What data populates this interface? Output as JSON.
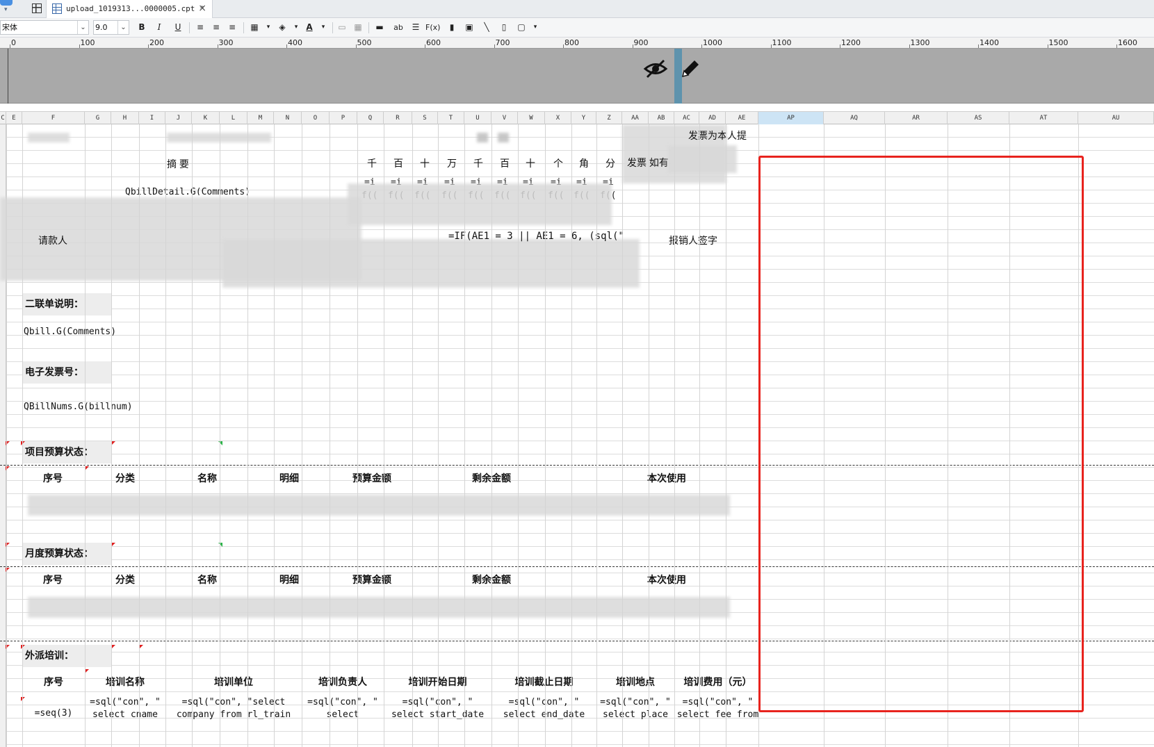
{
  "tab": {
    "title": "upload_1019313...0000005.cpt *",
    "close": "×"
  },
  "toolbar": {
    "font_name": "宋体",
    "font_size": "9.0",
    "bold": "B",
    "italic": "I",
    "underline": "U",
    "ab": "ab",
    "fx": "F(x)"
  },
  "ruler": {
    "labels": [
      "0",
      "100",
      "200",
      "300",
      "400",
      "500",
      "600",
      "700",
      "800",
      "900",
      "1000",
      "1100",
      "1200",
      "1300",
      "1400",
      "1500",
      "1600"
    ]
  },
  "columns": [
    "C",
    "E",
    "F",
    "G",
    "H",
    "I",
    "J",
    "K",
    "L",
    "M",
    "N",
    "O",
    "P",
    "Q",
    "R",
    "S",
    "T",
    "U",
    "V",
    "W",
    "X",
    "Y",
    "Z",
    "AA",
    "AB",
    "AC",
    "AD",
    "AE",
    "AP",
    "AQ",
    "AR",
    "AS",
    "AT",
    "AU"
  ],
  "selected_column": "AP",
  "sheet": {
    "top_note": "发票为本人提",
    "summary_header": "摘          要",
    "digit_headers": [
      "千",
      "百",
      "十",
      "万",
      "千",
      "百",
      "十",
      "个",
      "角",
      "分"
    ],
    "invoice_label": "发票 如有",
    "detail_formula": "QbillDetail.G(Comments)",
    "digit_formula_a": "=i",
    "digit_formula_b": "f((",
    "request_label": "请款人",
    "if_formula": "=IF(AE1 = 3 || AE1 = 6, (sql(\"",
    "sign_label": "报销人签字",
    "second_copy_label": "二联单说明：",
    "second_copy_formula": "Qbill.G(Comments)",
    "einvoice_label": "电子发票号：",
    "einvoice_formula": "QBillNums.G(billnum)",
    "project_budget_label": "项目预算状态：",
    "monthly_budget_label": "月度预算状态：",
    "budget_headers": [
      "序号",
      "分类",
      "名称",
      "明细",
      "预算金额",
      "剩余金额",
      "本次使用"
    ],
    "training_label": "外派培训：",
    "training_headers": [
      "序号",
      "培训名称",
      "培训单位",
      "培训负责人",
      "培训开始日期",
      "培训截止日期",
      "培训地点",
      "培训费用（元）"
    ],
    "training_row_line1": [
      "=seq(3)",
      "=sql(\"con\", \"",
      "=sql(\"con\", \"select",
      "=sql(\"con\", \"",
      "=sql(\"con\", \"",
      "=sql(\"con\", \"",
      "=sql(\"con\", \"",
      "=sql(\"con\", \""
    ],
    "training_row_line2": [
      "",
      "select cname",
      "company from rl_train",
      "select",
      "select start_date",
      "select end_date",
      "select place",
      "select fee from"
    ]
  },
  "icons": [
    "eye-slash-icon",
    "pencil-icon",
    "grid-icon",
    "doc-icon"
  ],
  "colors": {
    "highlight": "#e8231e",
    "selected_col": "#cde4f5",
    "band": "#a9a9a9"
  }
}
